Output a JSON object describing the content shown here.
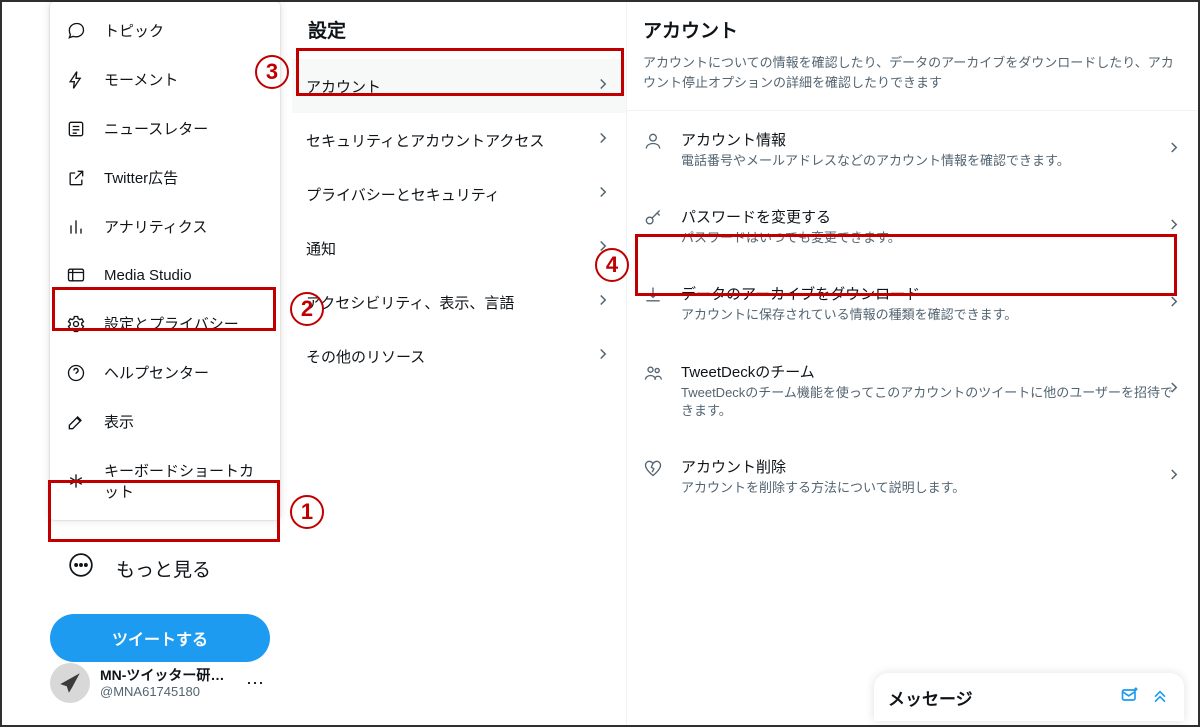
{
  "nav": {
    "items": [
      {
        "key": "topics",
        "label": "トピック"
      },
      {
        "key": "moments",
        "label": "モーメント"
      },
      {
        "key": "newsletter",
        "label": "ニュースレター"
      },
      {
        "key": "ads",
        "label": "Twitter広告"
      },
      {
        "key": "analytics",
        "label": "アナリティクス"
      },
      {
        "key": "mediastudio",
        "label": "Media Studio"
      },
      {
        "key": "settings",
        "label": "設定とプライバシー"
      },
      {
        "key": "help",
        "label": "ヘルプセンター"
      },
      {
        "key": "display",
        "label": "表示"
      },
      {
        "key": "shortcuts",
        "label": "キーボードショートカット"
      }
    ],
    "more_label": "もっと見る",
    "tweet_button": "ツイートする"
  },
  "profile": {
    "name": "MN-ツイッター研究所",
    "handle": "@MNA61745180"
  },
  "settings": {
    "title": "設定",
    "items": [
      {
        "label": "アカウント",
        "selected": true
      },
      {
        "label": "セキュリティとアカウントアクセス"
      },
      {
        "label": "プライバシーとセキュリティ"
      },
      {
        "label": "通知"
      },
      {
        "label": "アクセシビリティ、表示、言語"
      },
      {
        "label": "その他のリソース"
      }
    ]
  },
  "account": {
    "title": "アカウント",
    "description": "アカウントについての情報を確認したり、データのアーカイブをダウンロードしたり、アカウント停止オプションの詳細を確認したりできます",
    "items": [
      {
        "title": "アカウント情報",
        "subtitle": "電話番号やメールアドレスなどのアカウント情報を確認できます。"
      },
      {
        "title": "パスワードを変更する",
        "subtitle": "パスワードはいつでも変更できます。"
      },
      {
        "title": "データのアーカイブをダウンロード",
        "subtitle": "アカウントに保存されている情報の種類を確認できます。"
      },
      {
        "title": "TweetDeckのチーム",
        "subtitle": "TweetDeckのチーム機能を使ってこのアカウントのツイートに他のユーザーを招待できます。"
      },
      {
        "title": "アカウント削除",
        "subtitle": "アカウントを削除する方法について説明します。"
      }
    ]
  },
  "messages": {
    "title": "メッセージ"
  },
  "annotations": {
    "n1": "1",
    "n2": "2",
    "n3": "3",
    "n4": "4"
  },
  "colors": {
    "highlight": "#c00000",
    "accent": "#1d9bf0"
  }
}
